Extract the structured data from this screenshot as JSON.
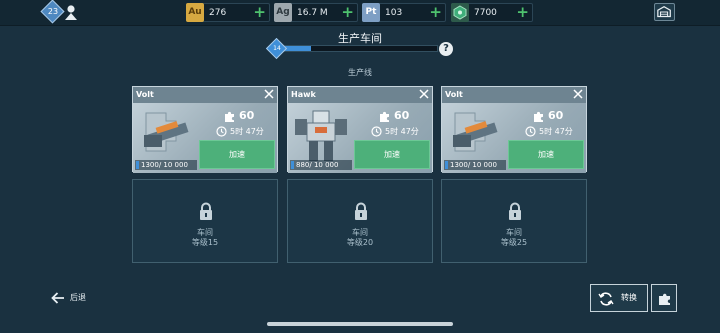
{
  "header": {
    "level": "23",
    "resources": [
      {
        "id": "au",
        "icon_label": "Au",
        "value": "276",
        "color": "#d7a941"
      },
      {
        "id": "ag",
        "icon_label": "Ag",
        "value": "16.7 M",
        "color": "#9ea8ae"
      },
      {
        "id": "pt",
        "icon_label": "Pt",
        "value": "103",
        "color": "#7e9fc4"
      },
      {
        "id": "key",
        "icon_label": "",
        "value": "7700",
        "color": "#3fae7a"
      }
    ]
  },
  "workshop": {
    "title": "生产车间",
    "level": "14",
    "progress_fraction": 0.2,
    "help": "?",
    "subtitle": "生产线"
  },
  "production": [
    {
      "name": "Volt",
      "pieces": "60",
      "time": "5时 47分",
      "button": "加速",
      "count": "1300/ 10 000"
    },
    {
      "name": "Hawk",
      "pieces": "60",
      "time": "5时 47分",
      "button": "加速",
      "count": "880/ 10 000"
    },
    {
      "name": "Volt",
      "pieces": "60",
      "time": "5时 47分",
      "button": "加速",
      "count": "1300/ 10 000"
    }
  ],
  "locked_slots": [
    {
      "label": "车间",
      "requirement": "等级15"
    },
    {
      "label": "车间",
      "requirement": "等级20"
    },
    {
      "label": "车间",
      "requirement": "等级25"
    }
  ],
  "footer": {
    "back": "后退",
    "switch": "转换"
  },
  "colors": {
    "background": "#1a3140",
    "accent_green": "#4db07a",
    "progress_blue": "#3f8fd8"
  }
}
